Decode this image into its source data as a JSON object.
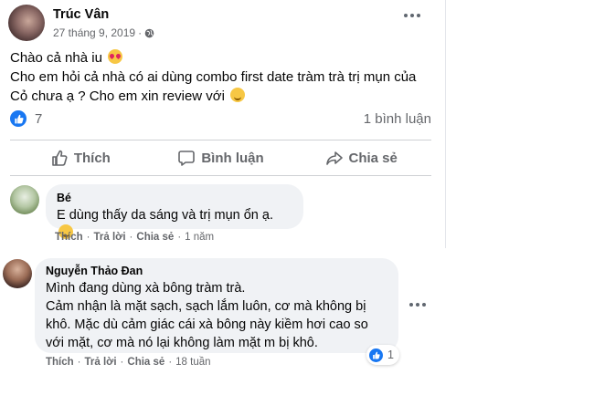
{
  "post": {
    "author": "Trúc Vân",
    "date": "27 tháng 9, 2019",
    "privacy_sep": "·",
    "lines": [
      "Chào cả nhà iu",
      "Cho em hỏi cả nhà có ai dùng combo first date tràm trà trị mụn của",
      "Cỏ chưa ạ ? Cho em xin review với"
    ],
    "like_count": "7",
    "comment_count": "1 bình luận",
    "actions": {
      "like": "Thích",
      "comment": "Bình luận",
      "share": "Chia sẻ"
    }
  },
  "comments": [
    {
      "name": "Bé",
      "text": "E dùng thấy da sáng và trị mụn ổn ạ.",
      "like": "Thích",
      "reply": "Trả lời",
      "share": "Chia sẻ",
      "sep": "·",
      "time": "1 năm"
    },
    {
      "name": "Nguyễn Thảo Đan",
      "lines": [
        "Mình đang dùng xà bông tràm trà.",
        "Cảm nhận là mặt sạch, sạch lắm luôn, cơ mà không bị",
        "khô. Mặc dù cảm giác cái xà bông này kiềm hơi cao so",
        "với mặt, cơ mà nó lại không làm mặt m bị khô."
      ],
      "reaction_count": "1",
      "like": "Thích",
      "reply": "Trả lời",
      "share": "Chia sẻ",
      "sep": "·",
      "time": "18 tuần"
    }
  ],
  "colors": {
    "accent": "#1877f2",
    "muted": "#65676b",
    "bubble": "#f0f2f5"
  }
}
